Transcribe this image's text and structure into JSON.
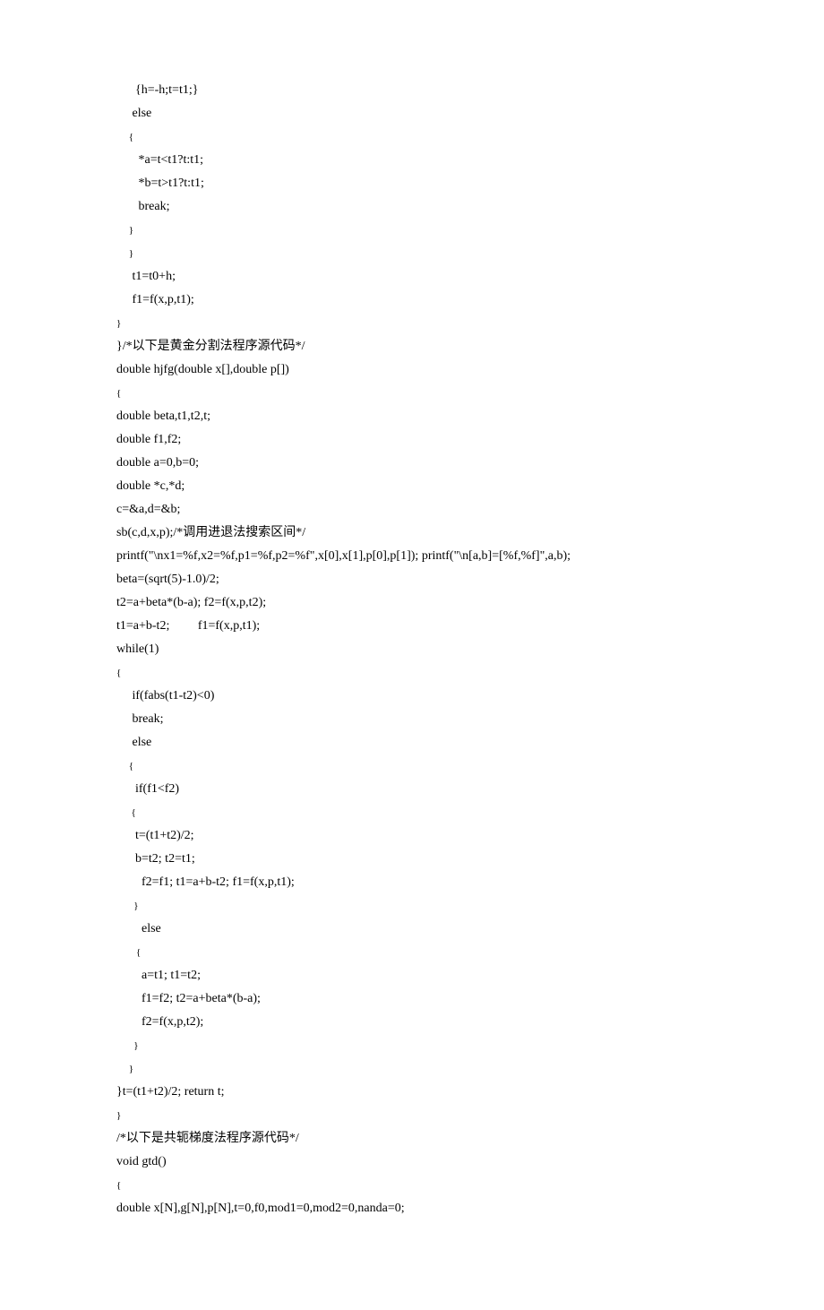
{
  "lines": [
    {
      "text": "      {h=-h;t=t1;}",
      "cls": ""
    },
    {
      "text": "     else",
      "cls": ""
    },
    {
      "text": "     {",
      "cls": "brace"
    },
    {
      "text": "       *a=t<t1?t:t1;",
      "cls": ""
    },
    {
      "text": "       *b=t>t1?t:t1;",
      "cls": ""
    },
    {
      "text": "       break;",
      "cls": ""
    },
    {
      "text": "     }",
      "cls": "brace"
    },
    {
      "text": "     }",
      "cls": "brace"
    },
    {
      "text": "     t1=t0+h;",
      "cls": ""
    },
    {
      "text": "     f1=f(x,p,t1);",
      "cls": ""
    },
    {
      "text": "}",
      "cls": "brace"
    },
    {
      "text": "}/*以下是黄金分割法程序源代码*/",
      "cls": "cn"
    },
    {
      "text": "double hjfg(double x[],double p[])",
      "cls": ""
    },
    {
      "text": "{",
      "cls": "brace"
    },
    {
      "text": "double beta,t1,t2,t;",
      "cls": ""
    },
    {
      "text": "double f1,f2;",
      "cls": ""
    },
    {
      "text": "double a=0,b=0;",
      "cls": ""
    },
    {
      "text": "double *c,*d;",
      "cls": ""
    },
    {
      "text": "c=&a,d=&b;",
      "cls": ""
    },
    {
      "text": "sb(c,d,x,p);/*调用进退法搜索区间*/",
      "cls": "cn"
    },
    {
      "text": "printf(\"\\nx1=%f,x2=%f,p1=%f,p2=%f\",x[0],x[1],p[0],p[1]); printf(\"\\n[a,b]=[%f,%f]\",a,b);",
      "cls": ""
    },
    {
      "text": "beta=(sqrt(5)-1.0)/2;",
      "cls": ""
    },
    {
      "text": "t2=a+beta*(b-a); f2=f(x,p,t2);",
      "cls": ""
    },
    {
      "text": "t1=a+b-t2;         f1=f(x,p,t1);",
      "cls": ""
    },
    {
      "text": "while(1)",
      "cls": ""
    },
    {
      "text": "{",
      "cls": "brace"
    },
    {
      "text": "     if(fabs(t1-t2)<0)",
      "cls": ""
    },
    {
      "text": "     break;",
      "cls": ""
    },
    {
      "text": "     else",
      "cls": ""
    },
    {
      "text": "     {",
      "cls": "brace"
    },
    {
      "text": "      if(f1<f2)",
      "cls": ""
    },
    {
      "text": "      {",
      "cls": "brace"
    },
    {
      "text": "      t=(t1+t2)/2;",
      "cls": ""
    },
    {
      "text": "      b=t2; t2=t1;",
      "cls": ""
    },
    {
      "text": "        f2=f1; t1=a+b-t2; f1=f(x,p,t1);",
      "cls": ""
    },
    {
      "text": "       }",
      "cls": "brace"
    },
    {
      "text": "        else",
      "cls": ""
    },
    {
      "text": "        {",
      "cls": "brace"
    },
    {
      "text": "        a=t1; t1=t2;",
      "cls": ""
    },
    {
      "text": "        f1=f2; t2=a+beta*(b-a);",
      "cls": ""
    },
    {
      "text": "        f2=f(x,p,t2);",
      "cls": ""
    },
    {
      "text": "       }",
      "cls": "brace"
    },
    {
      "text": "     }",
      "cls": "brace"
    },
    {
      "text": "}t=(t1+t2)/2; return t;",
      "cls": ""
    },
    {
      "text": "}",
      "cls": "brace"
    },
    {
      "text": "/*以下是共轭梯度法程序源代码*/",
      "cls": "cn"
    },
    {
      "text": "void gtd()",
      "cls": ""
    },
    {
      "text": "{",
      "cls": "brace"
    },
    {
      "text": "double x[N],g[N],p[N],t=0,f0,mod1=0,mod2=0,nanda=0;",
      "cls": ""
    }
  ]
}
